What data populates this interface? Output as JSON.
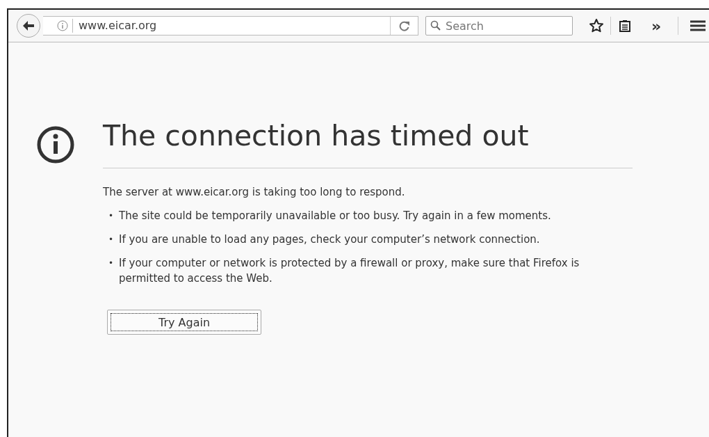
{
  "toolbar": {
    "url": "www.eicar.org",
    "search": {
      "placeholder": "Search"
    },
    "overflow": "»"
  },
  "error": {
    "title": "The connection has timed out",
    "intro": "The server at www.eicar.org is taking too long to respond.",
    "bullets": [
      {
        "marker": "•",
        "text": "The site could be temporarily unavailable or too busy. Try again in a few moments."
      },
      {
        "marker": "•",
        "text": "If you are unable to load any pages, check your computer’s network connection."
      },
      {
        "marker": "•",
        "text": "If your computer or network is protected by a firewall or proxy, make sure that Firefox is permitted to access the Web."
      }
    ],
    "button": {
      "label": "Try Again",
      "focused": true
    }
  }
}
